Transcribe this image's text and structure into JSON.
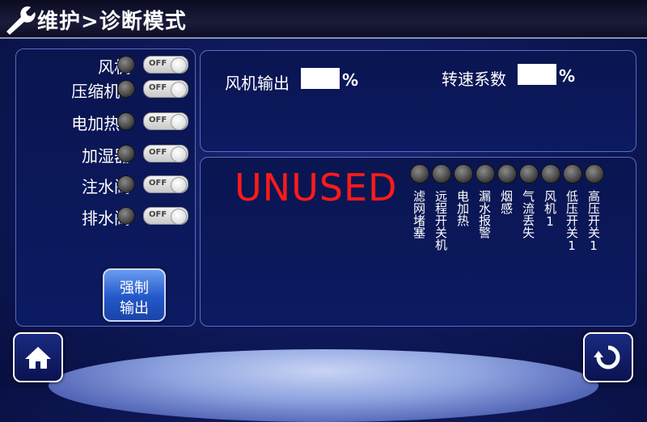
{
  "title": {
    "text": "维护>诊断模式",
    "icon": "wrench-icon"
  },
  "outputs": [
    {
      "label": "风机",
      "toggle": "OFF"
    },
    {
      "label": "压缩机1",
      "toggle": "OFF"
    },
    {
      "label": "电加热1",
      "toggle": "OFF"
    },
    {
      "label": "加湿器",
      "toggle": "OFF"
    },
    {
      "label": "注水阀",
      "toggle": "OFF"
    },
    {
      "label": "排水阀",
      "toggle": "OFF"
    }
  ],
  "force_button": {
    "line1": "强制",
    "line2": "输出"
  },
  "fan_output": {
    "label": "风机输出",
    "value": "",
    "unit": "%"
  },
  "speed_coef": {
    "label": "转速系数",
    "value": "",
    "unit": "%"
  },
  "unused_label": "UNUSED",
  "alarms": [
    {
      "label": "滤网堵塞"
    },
    {
      "label": "远程开关机"
    },
    {
      "label": "电加热"
    },
    {
      "label": "漏水报警"
    },
    {
      "label": "烟感"
    },
    {
      "label": "气流丢失"
    },
    {
      "label": "风机1"
    },
    {
      "label": "低压开关1"
    },
    {
      "label": "高压开关1"
    }
  ],
  "nav": {
    "home_icon": "home-icon",
    "back_icon": "back-arrow-icon"
  },
  "colors": {
    "unused": "#ff1a1a",
    "accent": "#2357c8"
  }
}
